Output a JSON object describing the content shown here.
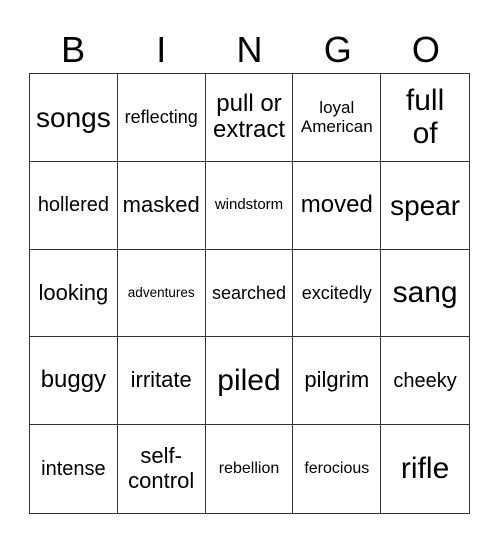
{
  "header": {
    "letters": [
      "B",
      "I",
      "N",
      "G",
      "O"
    ]
  },
  "grid": {
    "rows": [
      [
        "songs",
        "reflecting",
        "pull or\nextract",
        "loyal\nAmerican",
        "full\nof"
      ],
      [
        "hollered",
        "masked",
        "windstorm",
        "moved",
        "spear"
      ],
      [
        "looking",
        "adventures",
        "searched",
        "excitedly",
        "sang"
      ],
      [
        "buggy",
        "irritate",
        "piled",
        "pilgrim",
        "cheeky"
      ],
      [
        "intense",
        "self-\ncontrol",
        "rebellion",
        "ferocious",
        "rifle"
      ]
    ]
  }
}
